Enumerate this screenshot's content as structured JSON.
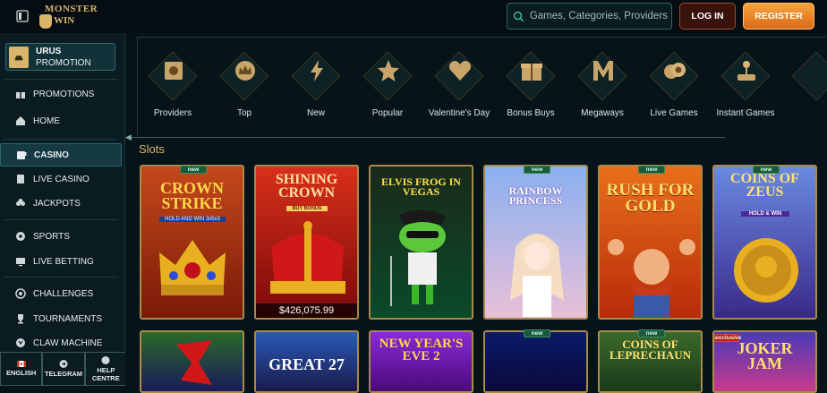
{
  "header": {
    "logo_line1": "MONSTER",
    "logo_line2": "WIN",
    "search_placeholder": "Games, Categories, Providers",
    "login_label": "LOG IN",
    "register_label": "REGISTER"
  },
  "sidebar": {
    "promo_title": "URUS",
    "promo_sub": "PROMOTION",
    "items": [
      {
        "label": "PROMOTIONS",
        "icon": "gift-icon"
      },
      {
        "label": "HOME",
        "icon": "home-icon"
      },
      {
        "label": "CASINO",
        "icon": "slot-machine-icon"
      },
      {
        "label": "LIVE CASINO",
        "icon": "cards-icon"
      },
      {
        "label": "JACKPOTS",
        "icon": "clover-icon"
      },
      {
        "label": "SPORTS",
        "icon": "ball-icon"
      },
      {
        "label": "LIVE BETTING",
        "icon": "screen-icon"
      },
      {
        "label": "CHALLENGES",
        "icon": "target-icon"
      },
      {
        "label": "TOURNAMENTS",
        "icon": "trophy-icon"
      },
      {
        "label": "CLAW MACHINE",
        "icon": "claw-icon"
      }
    ],
    "active": "CASINO",
    "bottom": [
      {
        "label": "ENGLISH",
        "icon": "canada-flag-icon"
      },
      {
        "label": "TELEGRAM",
        "icon": "telegram-icon"
      },
      {
        "label": "HELP CENTRE",
        "icon": "help-icon"
      }
    ]
  },
  "categories": [
    {
      "label": "Providers",
      "icon": "providers-icon"
    },
    {
      "label": "Top",
      "icon": "crown-icon"
    },
    {
      "label": "New",
      "icon": "lightning-icon"
    },
    {
      "label": "Popular",
      "icon": "star-icon"
    },
    {
      "label": "Valentine's Day",
      "icon": "heart-icon"
    },
    {
      "label": "Bonus Buys",
      "icon": "gift-box-icon"
    },
    {
      "label": "Megaways",
      "icon": "m-letter-icon"
    },
    {
      "label": "Live Games",
      "icon": "chips-icon"
    },
    {
      "label": "Instant Games",
      "icon": "joystick-icon"
    }
  ],
  "section_title": "Slots",
  "games_row1": [
    {
      "name": "CROWN STRIKE",
      "sub": "HOLD AND WIN 3x5x3",
      "tag": "new",
      "color": "#b83a12"
    },
    {
      "name": "SHINING CROWN",
      "sub": "BUY BONUS",
      "tag": "",
      "jackpot": "$426,075.99",
      "color": "#c4201a"
    },
    {
      "name": "ELVIS FROG IN VEGAS",
      "sub": "",
      "tag": "",
      "color": "#1a3a1a"
    },
    {
      "name": "RAINBOW PRINCESS",
      "sub": "",
      "tag": "new",
      "color": "#9ab4e8"
    },
    {
      "name": "RUSH FOR GOLD",
      "sub": "",
      "tag": "new",
      "color": "#d8601a"
    },
    {
      "name": "COINS OF ZEUS",
      "sub": "HOLD & WIN",
      "tag": "new",
      "color": "#6a58b8"
    }
  ],
  "games_row2": [
    {
      "name": "",
      "tag": "",
      "color": "#1a2a6a"
    },
    {
      "name": "GREAT 27",
      "tag": "",
      "color": "#1a3a8a"
    },
    {
      "name": "NEW YEAR'S EVE 2",
      "tag": "",
      "color": "#6a1aa8"
    },
    {
      "name": "",
      "tag": "new",
      "color": "#0a1a5a"
    },
    {
      "name": "COINS OF LEPRECHAUN",
      "tag": "new",
      "color": "#2a4a1a"
    },
    {
      "name": "JOKER JAM",
      "tag": "exclusive",
      "color": "#3a2a8a"
    }
  ]
}
